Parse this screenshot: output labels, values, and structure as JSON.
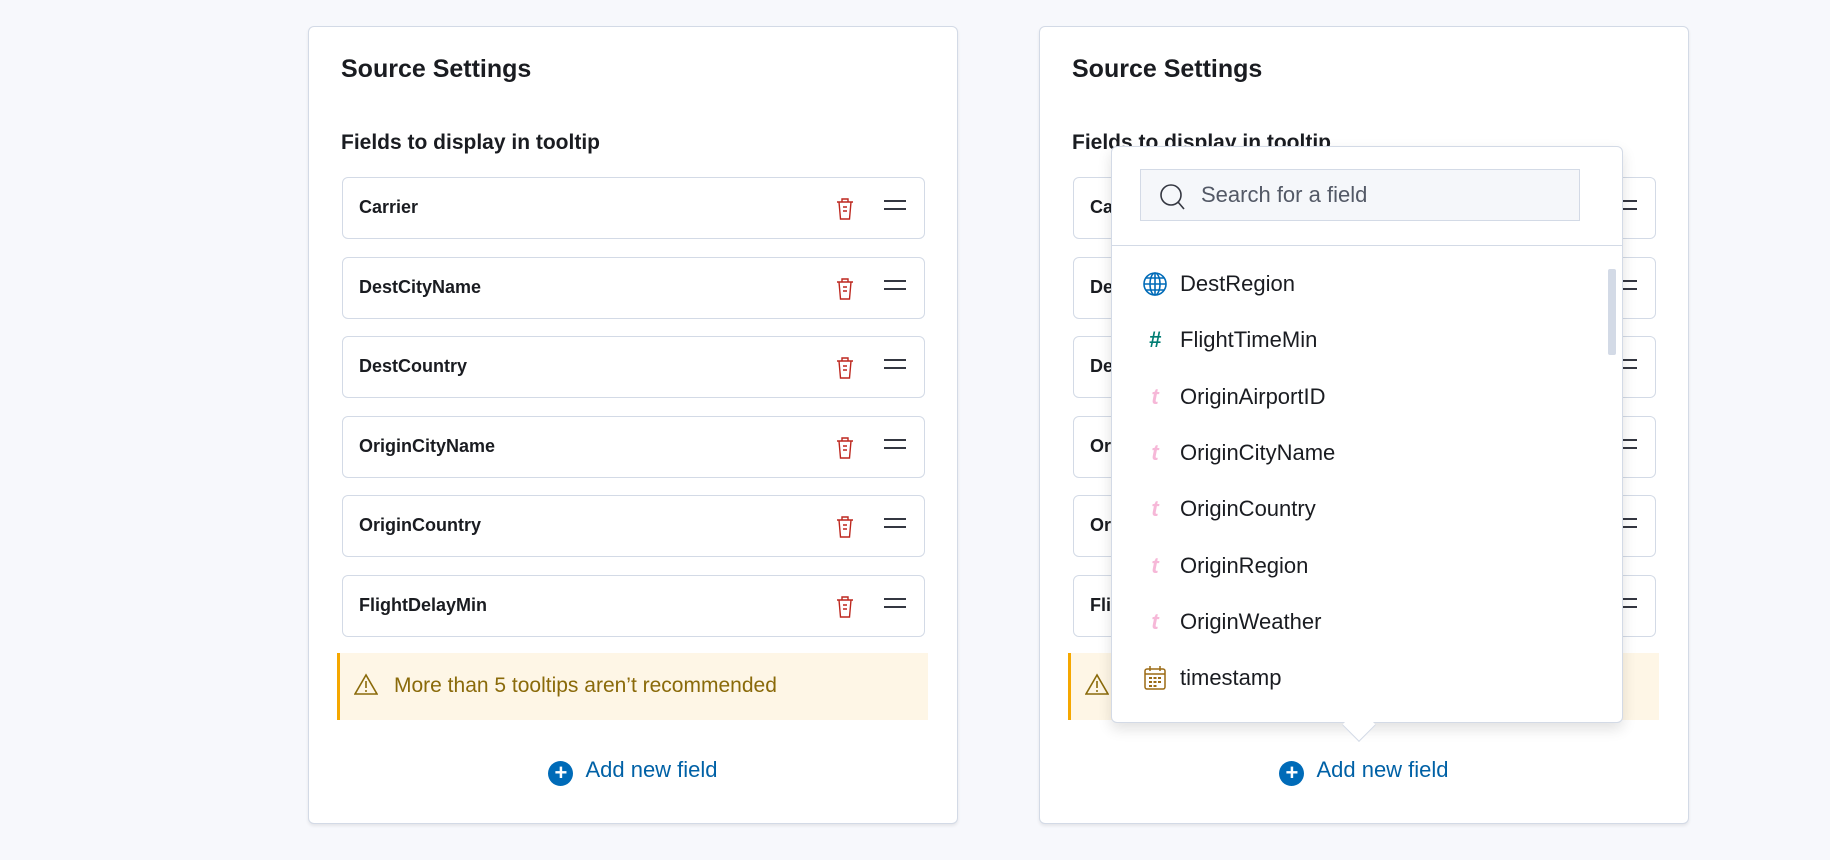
{
  "panel": {
    "title": "Source Settings",
    "subtitle": "Fields to display in tooltip",
    "fields": [
      {
        "label": "Carrier"
      },
      {
        "label": "DestCityName"
      },
      {
        "label": "DestCountry"
      },
      {
        "label": "OriginCityName"
      },
      {
        "label": "OriginCountry"
      },
      {
        "label": "FlightDelayMin"
      }
    ],
    "warning": "More than 5 tooltips aren’t recommended",
    "add_label": "Add new field",
    "add_icon": "plus-circle-icon"
  },
  "popover": {
    "search_placeholder": "Search for a field",
    "options": [
      {
        "label": "DestRegion",
        "type": "geo",
        "icon": "globe-icon",
        "color": "#006bb8"
      },
      {
        "label": "FlightTimeMin",
        "type": "number",
        "icon": "#",
        "color": "#017d73"
      },
      {
        "label": "OriginAirportID",
        "type": "string",
        "icon": "t",
        "color": "#f6b8d8"
      },
      {
        "label": "OriginCityName",
        "type": "string",
        "icon": "t",
        "color": "#f6b8d8"
      },
      {
        "label": "OriginCountry",
        "type": "string",
        "icon": "t",
        "color": "#f6b8d8"
      },
      {
        "label": "OriginRegion",
        "type": "string",
        "icon": "t",
        "color": "#f6b8d8"
      },
      {
        "label": "OriginWeather",
        "type": "string",
        "icon": "t",
        "color": "#f6b8d8"
      },
      {
        "label": "timestamp",
        "type": "date",
        "icon": "calendar-icon",
        "color": "#9b6a14"
      }
    ]
  },
  "colors": {
    "accent": "#006bb8",
    "danger": "#bd271e",
    "warning": "#f5a700"
  }
}
